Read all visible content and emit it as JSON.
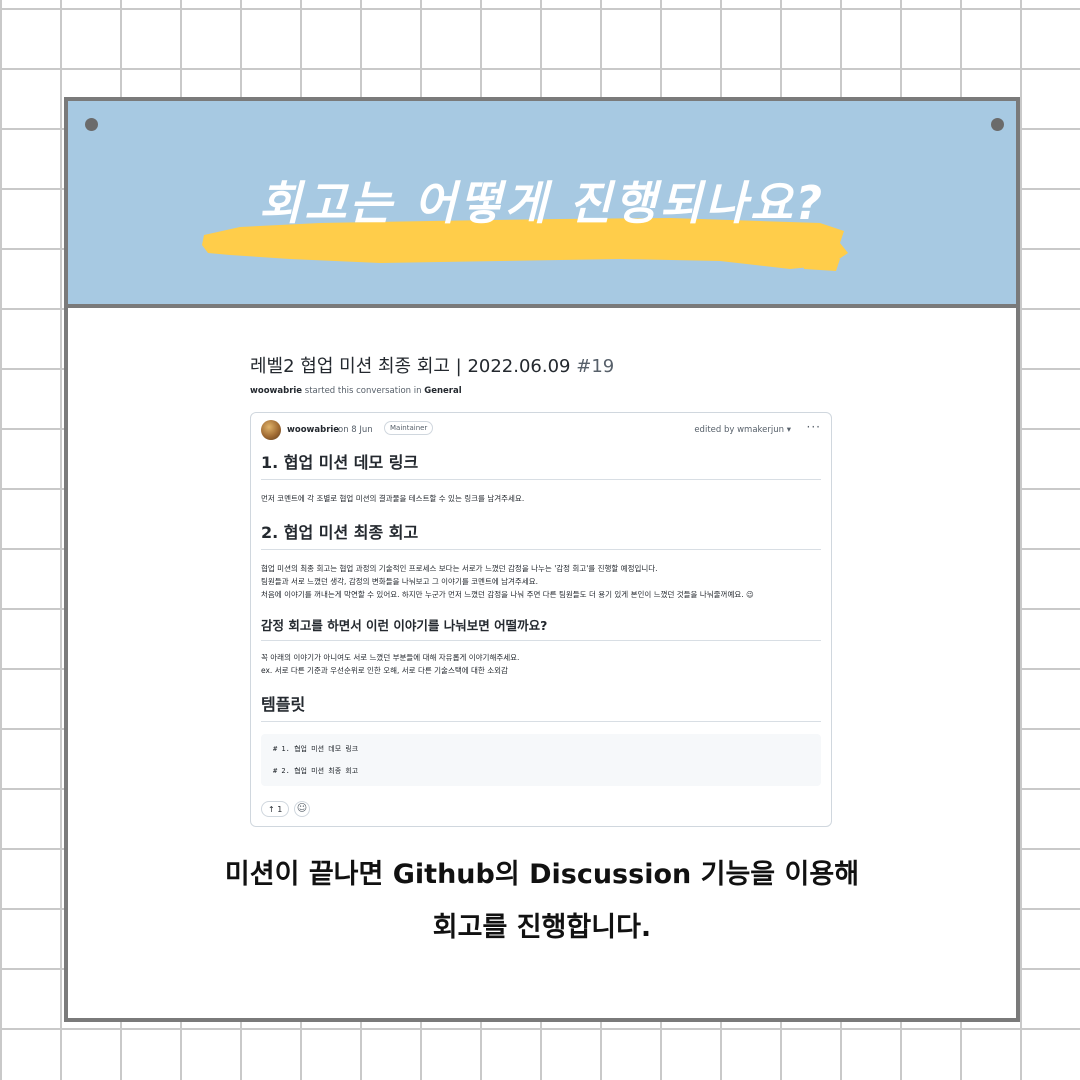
{
  "banner": {
    "title": "회고는 어떻게 진행되나요?",
    "highlight_color": "#ffcd4a",
    "background_color": "#a7c9e2"
  },
  "discussion": {
    "title": "레벨2 협업 미션 최종 회고 | 2022.06.09",
    "number": "#19",
    "started_user": "woowabrie",
    "started_text": "started this conversation in",
    "category": "General",
    "post": {
      "author": "woowabrie",
      "date": "on 8 Jun",
      "badge": "Maintainer",
      "edited": "edited by wmakerjun ▾",
      "more": "···",
      "sections": {
        "h1": "1. 협업 미션 데모 링크",
        "p1": "먼저 코멘트에 각 조별로 협업 미션의 결과물을 테스트할 수 있는 링크를 남겨주세요.",
        "h2": "2. 협업 미션 최종 회고",
        "p2_lines": [
          "협업 미션의 최종 회고는 협업 과정의 기술적인 프로세스 보다는 서로가 느꼈던 감정을 나누는 '감정 회고'를 진행할 예정입니다.",
          "팀원들과 서로 느꼈던 생각, 감정의 변화들을 나눠보고 그 이야기를 코멘트에 남겨주세요.",
          "처음에 이야기를 꺼내는게 막연할 수 있어요. 하지만 누군가 먼저 느꼈던 감정을 나눠 주면 다른 팀원들도 더 용기 있게 본인이 느꼈던 것들을 나눠줄꺼예요. 😉"
        ],
        "h3": "감정 회고를 하면서 이런 이야기를 나눠보면 어떨까요?",
        "p3_lines": [
          "꼭 아래의 이야기가 아니여도 서로 느꼈던 부분들에 대해 자유롭게 이야기해주세요.",
          "ex. 서로 다른 기준과 우선순위로 인한 오해, 서로 다른 기술스택에 대한 소외감"
        ],
        "h4": "템플릿",
        "code_lines": [
          "# 1. 협업 미션 데모 링크",
          "# 2. 협업 미션 최종 회고"
        ]
      },
      "upvote": "↑ 1",
      "emoji_icon": "smiley-icon"
    }
  },
  "caption": {
    "line1": "미션이 끝나면 Github의 Discussion 기능을 이용해",
    "line2": "회고를 진행합니다."
  }
}
